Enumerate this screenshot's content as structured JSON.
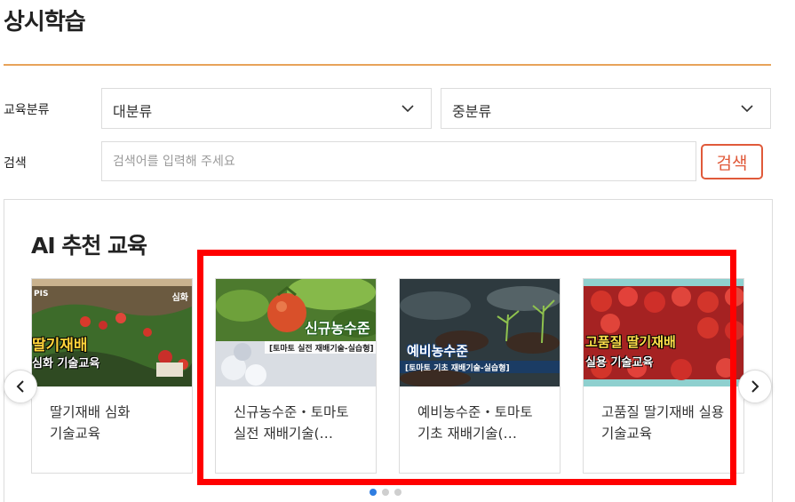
{
  "page_title": "상시학습",
  "filters": {
    "category_label": "교육분류",
    "major_select": "대분류",
    "minor_select": "중분류",
    "search_label": "검색",
    "search_placeholder": "검색어를 입력해 주세요",
    "search_button": "검색"
  },
  "recommend": {
    "title": "AI 추천 교육",
    "cards": [
      {
        "title": "딸기재배 심화 기술교육",
        "thumb_caption_1": "딸기재배",
        "thumb_caption_2": "심화 기술교육",
        "thumb_corner": "심화"
      },
      {
        "title": "신규농수준・토마토 실전 재배기술(…",
        "thumb_caption_1": "신규농수준",
        "thumb_caption_2": "[토마토 실전 재배기술-실습형]"
      },
      {
        "title": "예비농수준・토마토 기초 재배기술(…",
        "thumb_caption_1": "예비농수준",
        "thumb_caption_2": "[토마토 기초 재배기술-실습형]"
      },
      {
        "title": "고품질 딸기재배 실용 기술교육",
        "thumb_caption_1": "고품질 딸기재배",
        "thumb_caption_2": "실용 기술교육"
      }
    ],
    "logo_text": "PIS",
    "page_index": 0,
    "page_count": 3
  },
  "colors": {
    "accent_rule": "#e8a35a",
    "search_button": "#e05a3a",
    "highlight": "#ff0000",
    "active_dot": "#2f7de1"
  },
  "icons": {
    "select_arrow": "chevron-down-icon",
    "prev": "chevron-left-icon",
    "next": "chevron-right-icon"
  }
}
